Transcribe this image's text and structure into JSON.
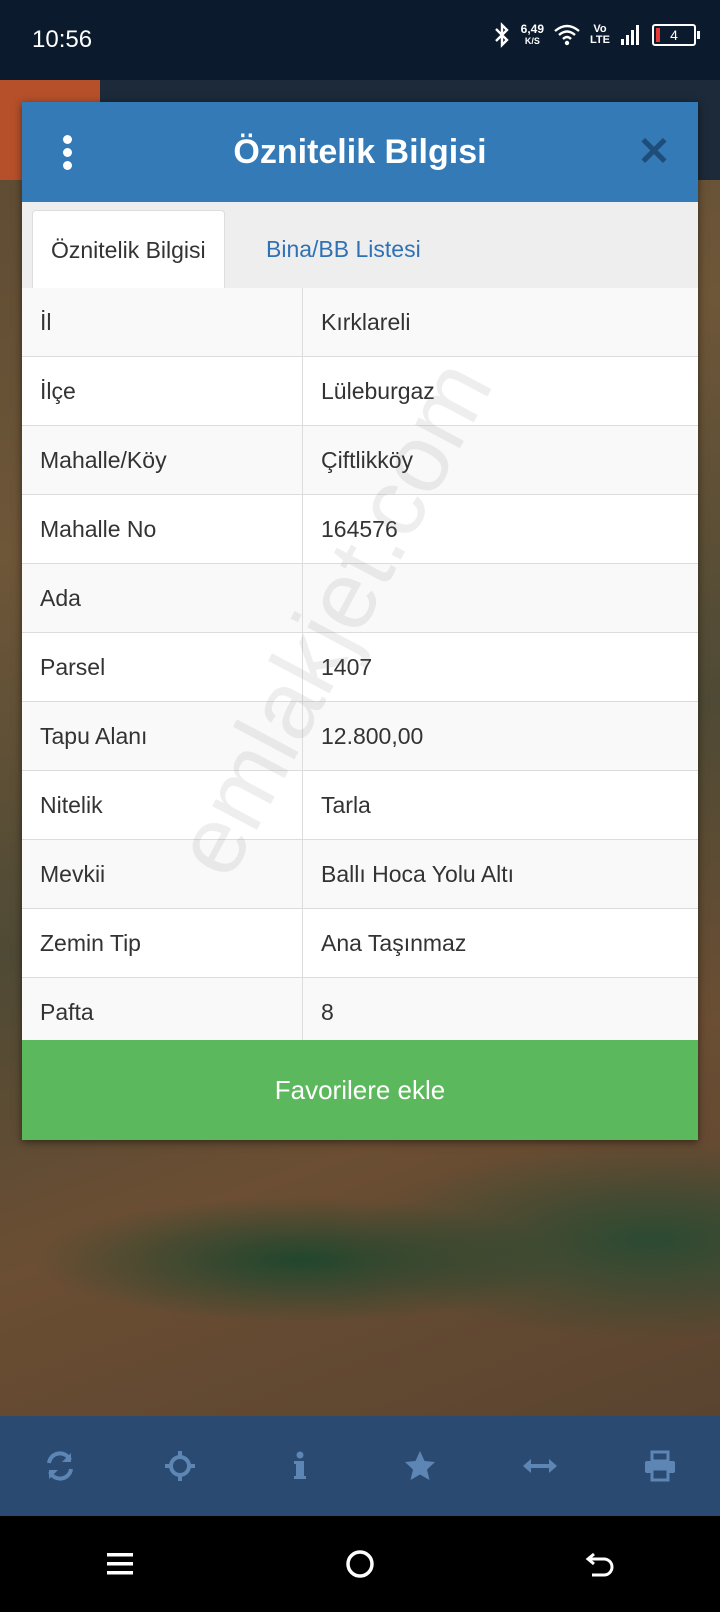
{
  "status": {
    "time": "10:56",
    "speed_value": "6,49",
    "speed_unit": "K/S",
    "network_top": "Vo",
    "network_bottom": "LTE",
    "battery": "4"
  },
  "dialog": {
    "title": "Öznitelik Bilgisi",
    "tabs": [
      "Öznitelik Bilgisi",
      "Bina/BB Listesi"
    ],
    "rows": [
      {
        "key": "İl",
        "value": "Kırklareli"
      },
      {
        "key": "İlçe",
        "value": "Lüleburgaz"
      },
      {
        "key": "Mahalle/Köy",
        "value": "Çiftlikköy"
      },
      {
        "key": "Mahalle No",
        "value": "164576"
      },
      {
        "key": "Ada",
        "value": ""
      },
      {
        "key": "Parsel",
        "value": "1407"
      },
      {
        "key": "Tapu Alanı",
        "value": "12.800,00"
      },
      {
        "key": "Nitelik",
        "value": "Tarla"
      },
      {
        "key": "Mevkii",
        "value": "Ballı Hoca Yolu Altı"
      },
      {
        "key": "Zemin Tip",
        "value": "Ana Taşınmaz"
      },
      {
        "key": "Pafta",
        "value": "8"
      }
    ],
    "favorite_button": "Favorilere ekle"
  },
  "watermark": "emlakjet.com",
  "toolbar_icons": [
    "refresh-icon",
    "locate-icon",
    "info-icon",
    "star-icon",
    "measure-icon",
    "print-icon"
  ],
  "colors": {
    "header": "#347ab7",
    "tab_link": "#2f72b3",
    "favorite": "#5cb85c",
    "toolbar": "#2a4a72"
  }
}
